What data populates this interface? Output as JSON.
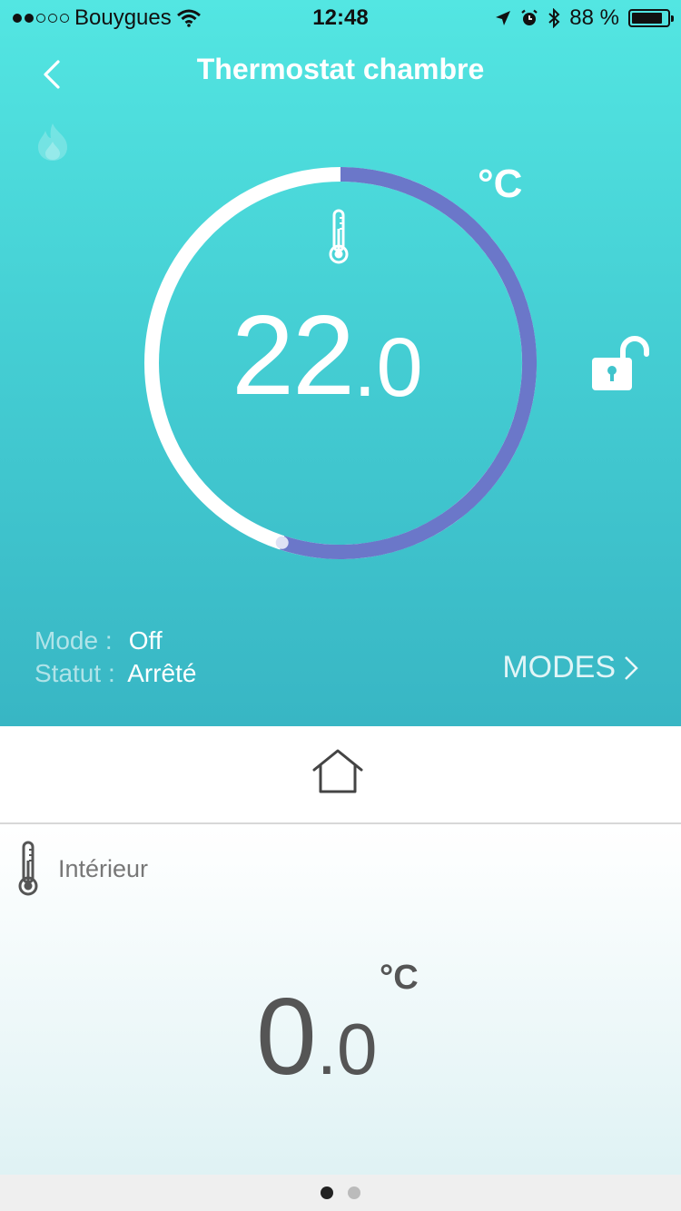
{
  "status_bar": {
    "carrier": "Bouygues",
    "time": "12:48",
    "battery": "88 %",
    "battery_level": 0.88
  },
  "header": {
    "title": "Thermostat chambre"
  },
  "dial": {
    "unit": "°C",
    "temp_int": "22",
    "temp_dec": ".0",
    "arc_fraction": 0.55,
    "arc_color": "#6b77c9",
    "track_color": "#ffffff"
  },
  "info": {
    "mode_label": "Mode :",
    "mode_value": "Off",
    "statut_label": "Statut :",
    "statut_value": "Arrêté"
  },
  "modes_link": "MODES",
  "interior": {
    "label": "Intérieur",
    "unit": "°C",
    "temp_int": "0",
    "temp_dec": ".0"
  },
  "pager": {
    "pages": 2,
    "active": 0
  },
  "icons": [
    "wifi-icon",
    "location-icon",
    "alarm-icon",
    "bluetooth-icon",
    "back-chevron-icon",
    "flame-icon",
    "thermometer-icon",
    "unlock-icon",
    "home-icon",
    "chevron-right-icon"
  ]
}
